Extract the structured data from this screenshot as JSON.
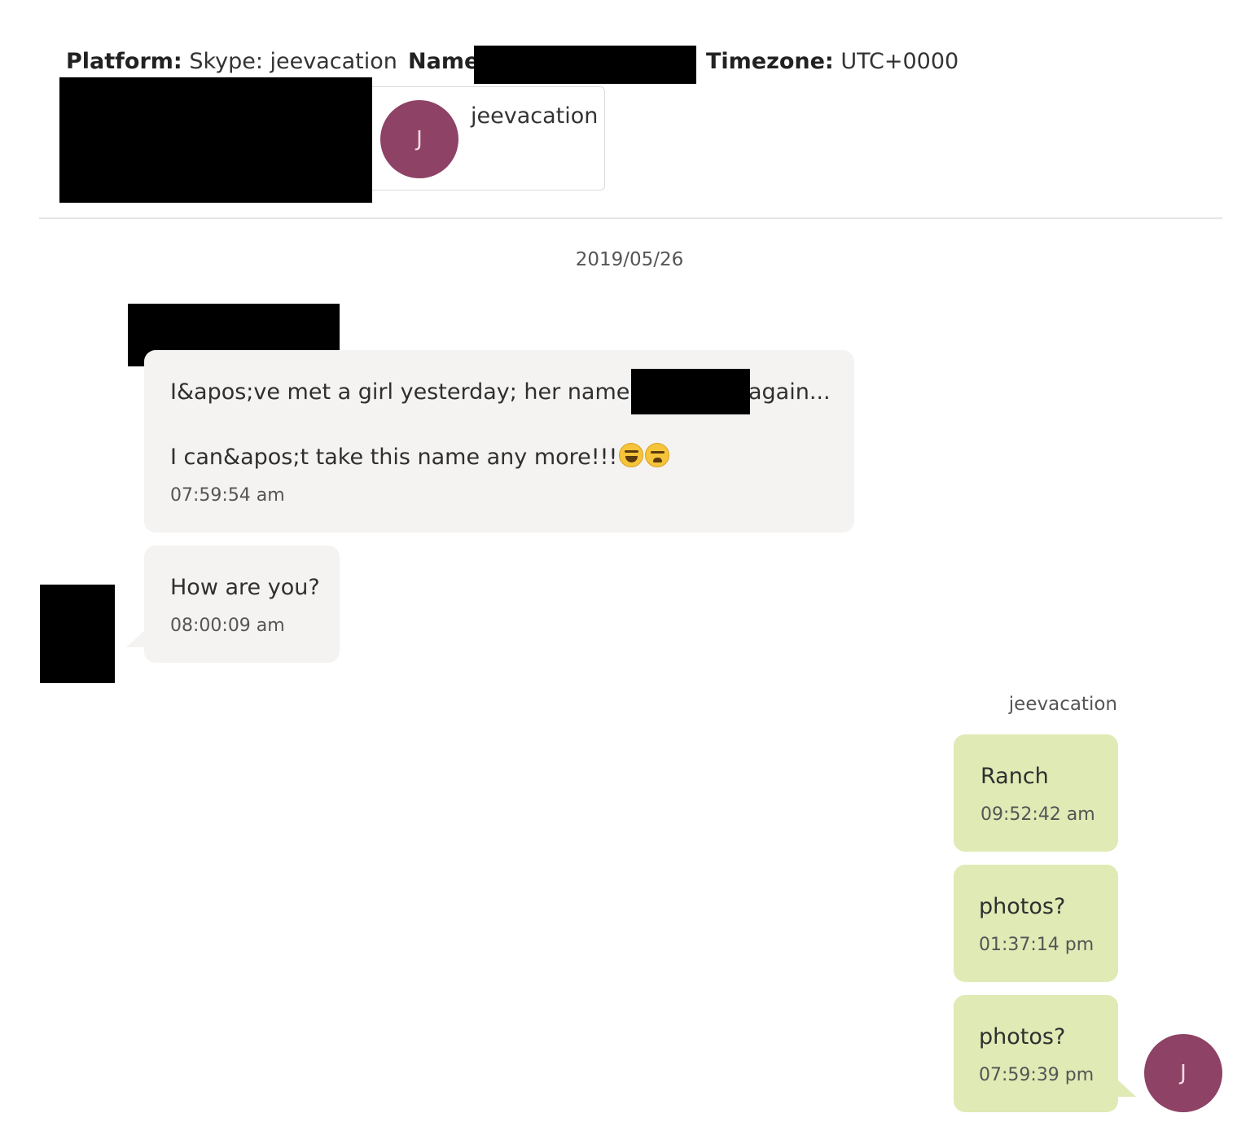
{
  "header": {
    "platform_label": "Platform:",
    "platform_value": "Skype: jeevacation",
    "name_label": "Name",
    "timezone_label": "Timezone:",
    "timezone_value": "UTC+0000"
  },
  "participant_card": {
    "avatar_initial": "J",
    "username": "jeevacation",
    "avatar_color": "#8e4266"
  },
  "date_separator": "2019/05/26",
  "incoming_messages": [
    {
      "line1_before": "I&apos;ve met a girl yesterday; her name is",
      "line1_after": "again...",
      "line2": "I can&apos;t take this name any more!!!",
      "emojis": [
        "laughing-face-icon",
        "tired-face-icon"
      ],
      "time": "07:59:54 am"
    },
    {
      "text": "How are you?",
      "time": "08:00:09 am"
    }
  ],
  "outgoing_sender": "jeevacation",
  "outgoing_messages": [
    {
      "text": "Ranch",
      "time": "09:52:42 am"
    },
    {
      "text": "photos?",
      "time": "01:37:14 pm"
    },
    {
      "text": "photos?",
      "time": "07:59:39 pm"
    }
  ],
  "outgoing_avatar_initial": "J",
  "colors": {
    "incoming_bubble": "#f4f3f2",
    "outgoing_bubble": "#dfeab5",
    "avatar": "#8e4266",
    "redaction": "#000000"
  }
}
